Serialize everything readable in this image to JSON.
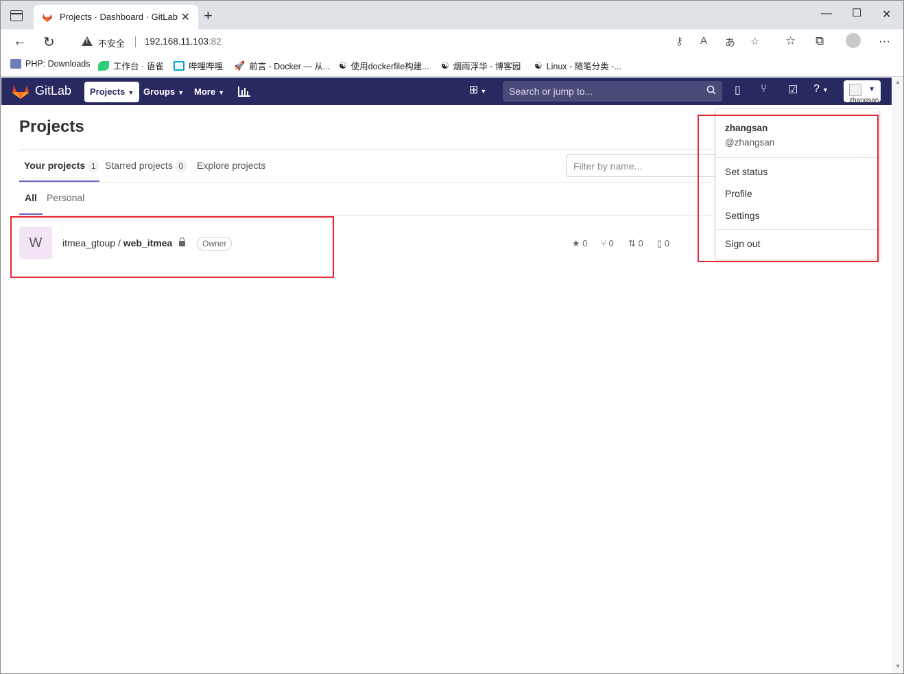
{
  "browser": {
    "tab_title": "Projects · Dashboard · GitLab",
    "insecure_label": "不安全",
    "url_host": "192.168.11.103",
    "url_port": ":82",
    "bookmarks": [
      {
        "label": "PHP: Downloads",
        "icon": "php-icon"
      },
      {
        "label": "工作台 · 语雀",
        "icon": "yuque-icon"
      },
      {
        "label": "哔哩哔哩",
        "icon": "bilibili-icon"
      },
      {
        "label": "前言 - Docker — 从...",
        "icon": "rocket-icon"
      },
      {
        "label": "使用dockerfile构建...",
        "icon": "cnblogs-icon"
      },
      {
        "label": "烟雨浮华 - 博客园",
        "icon": "cnblogs-icon"
      },
      {
        "label": "Linux - 随笔分类 -...",
        "icon": "cnblogs-icon"
      }
    ]
  },
  "gitlab": {
    "brand": "GitLab",
    "nav": {
      "projects": "Projects",
      "groups": "Groups",
      "more": "More"
    },
    "search_placeholder": "Search or jump to...",
    "avatar_alt": "zhangsan"
  },
  "page": {
    "title": "Projects",
    "tabs": [
      {
        "label": "Your projects",
        "count": "1"
      },
      {
        "label": "Starred projects",
        "count": "0"
      },
      {
        "label": "Explore projects"
      }
    ],
    "filter_placeholder": "Filter by name...",
    "subtabs": [
      "All",
      "Personal"
    ]
  },
  "project": {
    "avatar_letter": "W",
    "namespace": "itmea_gtoup / ",
    "name": "web_itmea",
    "role": "Owner",
    "stars": "0",
    "forks": "0",
    "merge_requests": "0",
    "issues": "0"
  },
  "user_menu": {
    "name": "zhangsan",
    "username": "@zhangsan",
    "set_status": "Set status",
    "profile": "Profile",
    "settings": "Settings",
    "sign_out": "Sign out"
  }
}
